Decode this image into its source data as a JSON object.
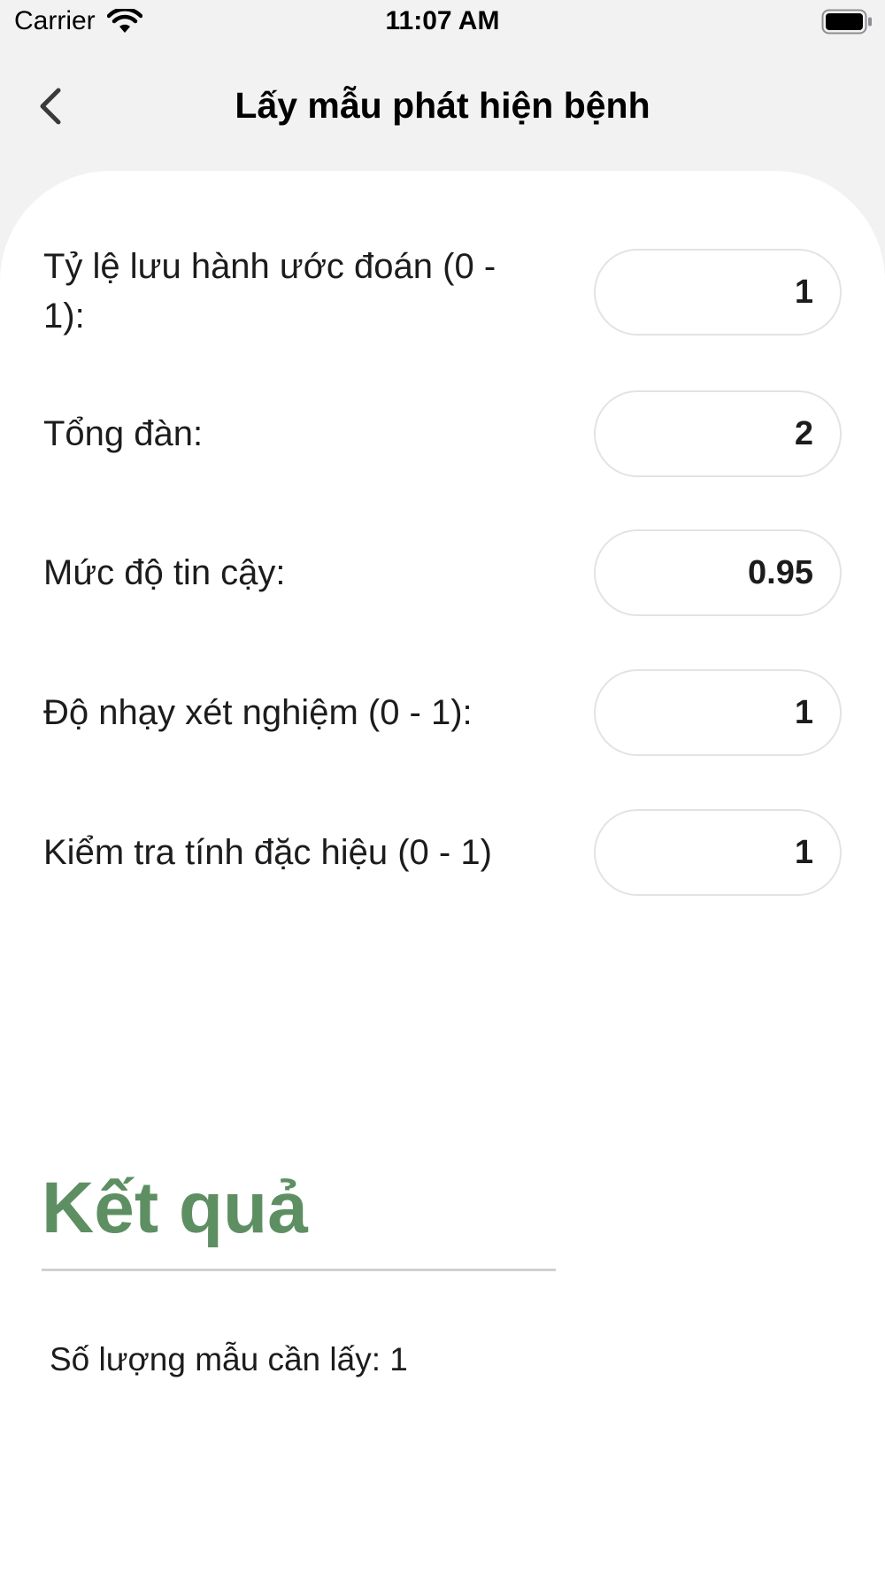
{
  "status_bar": {
    "carrier": "Carrier",
    "time": "11:07 AM",
    "wifi_icon": "wifi-icon",
    "battery_icon": "battery-icon"
  },
  "nav": {
    "back_icon": "chevron-left-icon",
    "title": "Lấy mẫu phát hiện bệnh"
  },
  "form": {
    "fields": [
      {
        "label": "Tỷ lệ lưu hành ước đoán (0 - 1):",
        "value": "1"
      },
      {
        "label": "Tổng đàn:",
        "value": "2"
      },
      {
        "label": "Mức độ tin cậy:",
        "value": "0.95"
      },
      {
        "label": "Độ nhạy xét nghiệm (0 - 1):",
        "value": "1"
      },
      {
        "label": "Kiểm tra tính đặc hiệu (0 - 1)",
        "value": "1"
      }
    ]
  },
  "result": {
    "title": "Kết quả",
    "text": "Số lượng mẫu cần lấy: 1"
  },
  "colors": {
    "accent": "#5e8f63",
    "background": "#f2f2f2",
    "card": "#ffffff",
    "input_border": "#e3e3e3"
  }
}
